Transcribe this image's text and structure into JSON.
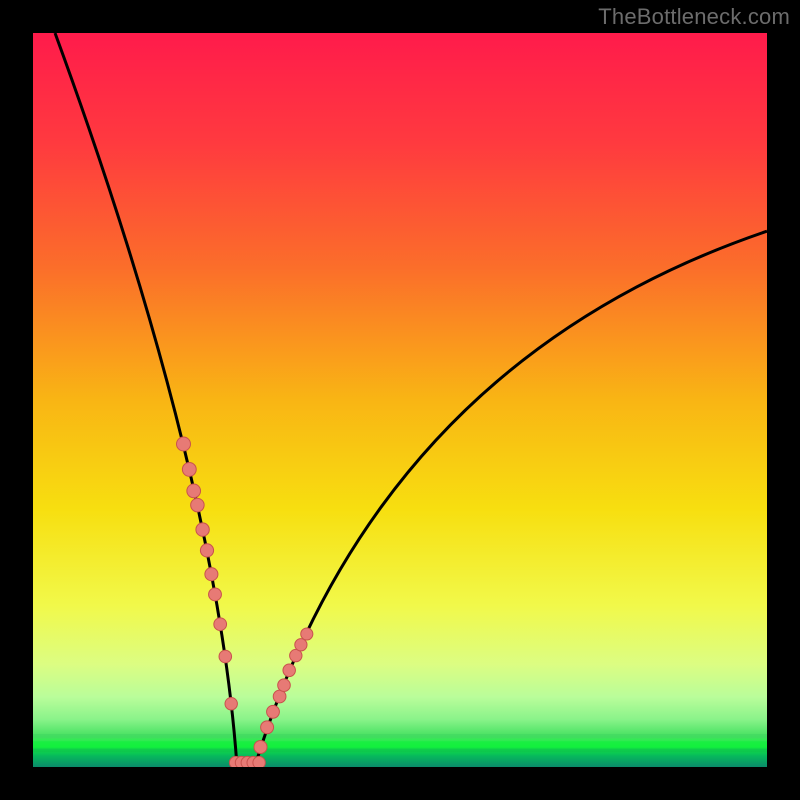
{
  "watermark": {
    "text": "TheBottleneck.com"
  },
  "colors": {
    "frame": "#000000",
    "curve": "#000000",
    "marker_fill": "#e77a75",
    "marker_stroke": "#c9524d",
    "green_band": "#3fd661",
    "bright_green": "#13f03d"
  },
  "chart_data": {
    "type": "line",
    "title": "",
    "xlabel": "",
    "ylabel": "",
    "xlim": [
      0,
      100
    ],
    "ylim": [
      0,
      100
    ],
    "grid": false,
    "legend": null,
    "curve": {
      "description": "Asymmetric V-shaped bottleneck curve. Left branch steep, right branch shallow. Minimum value 0 at bottleneck_x.",
      "bottleneck_x": 29,
      "left_start": {
        "x": 3,
        "y": 100
      },
      "left_control": {
        "x": 25,
        "y": 40
      },
      "right_end": {
        "x": 100,
        "y": 73
      },
      "right_control": {
        "x": 47,
        "y": 55
      }
    },
    "left_markers_x": [
      20.5,
      21.3,
      21.9,
      22.4,
      23.1,
      23.7,
      24.3,
      24.8,
      25.5,
      26.2,
      27.0,
      27.8,
      28.6
    ],
    "right_markers_x": [
      30.2,
      31.0,
      31.9,
      32.7,
      33.6,
      34.2,
      34.9,
      35.8,
      36.5,
      37.3
    ],
    "floor_markers_x": [
      27.6,
      28.4,
      29.2,
      30.0,
      30.8
    ],
    "gradient_stops": [
      {
        "offset": 0.0,
        "color": "#ff1b4b"
      },
      {
        "offset": 0.15,
        "color": "#ff3a3f"
      },
      {
        "offset": 0.32,
        "color": "#fb6e2a"
      },
      {
        "offset": 0.5,
        "color": "#f9b514"
      },
      {
        "offset": 0.65,
        "color": "#f7df10"
      },
      {
        "offset": 0.78,
        "color": "#f1f94a"
      },
      {
        "offset": 0.86,
        "color": "#dcfd82"
      },
      {
        "offset": 0.905,
        "color": "#b9fd9a"
      },
      {
        "offset": 0.935,
        "color": "#8af38a"
      },
      {
        "offset": 0.955,
        "color": "#4fe466"
      },
      {
        "offset": 0.972,
        "color": "#13f03d"
      },
      {
        "offset": 0.985,
        "color": "#07b85c"
      },
      {
        "offset": 1.0,
        "color": "#0a8b6a"
      }
    ]
  }
}
